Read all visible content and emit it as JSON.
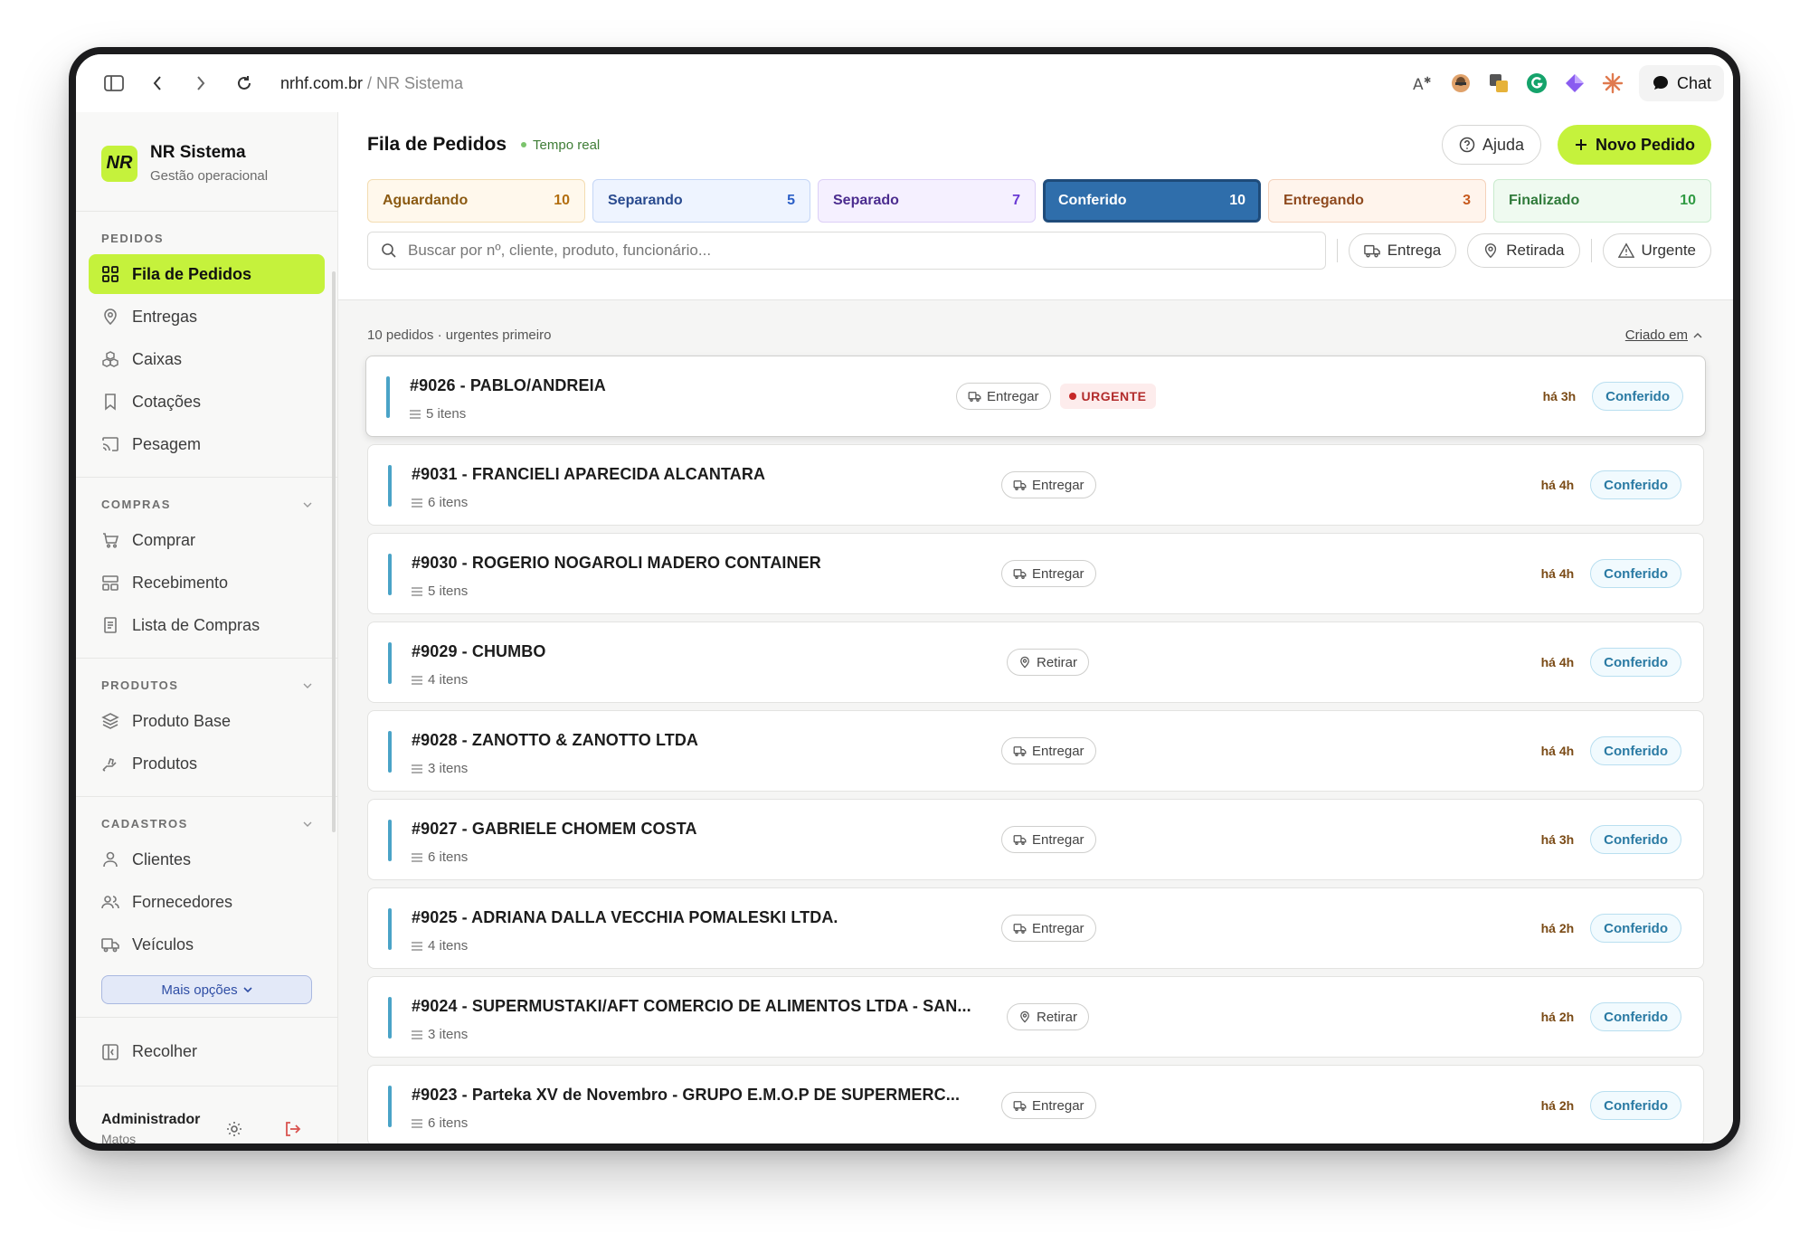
{
  "browser": {
    "domain": "nrhf.com.br",
    "path_sep": " / ",
    "page": "NR Sistema",
    "chat_label": "Chat"
  },
  "brand": {
    "logo": "NR",
    "name": "NR Sistema",
    "subtitle": "Gestão operacional"
  },
  "sidebar": {
    "sections": [
      {
        "title": "PEDIDOS",
        "items": [
          {
            "label": "Fila de Pedidos",
            "icon": "grid-icon",
            "active": true
          },
          {
            "label": "Entregas",
            "icon": "map-pin-icon"
          },
          {
            "label": "Caixas",
            "icon": "boxes-icon"
          },
          {
            "label": "Cotações",
            "icon": "bookmark-icon"
          },
          {
            "label": "Pesagem",
            "icon": "cast-icon"
          }
        ]
      },
      {
        "title": "COMPRAS",
        "items": [
          {
            "label": "Comprar",
            "icon": "cart-icon"
          },
          {
            "label": "Recebimento",
            "icon": "layout-icon"
          },
          {
            "label": "Lista de Compras",
            "icon": "list-doc-icon"
          }
        ]
      },
      {
        "title": "PRODUTOS",
        "items": [
          {
            "label": "Produto Base",
            "icon": "layers-icon"
          },
          {
            "label": "Produtos",
            "icon": "hand-icon"
          }
        ]
      },
      {
        "title": "CADASTROS",
        "items": [
          {
            "label": "Clientes",
            "icon": "user-icon"
          },
          {
            "label": "Fornecedores",
            "icon": "users-icon"
          },
          {
            "label": "Veículos",
            "icon": "truck-icon"
          }
        ]
      }
    ],
    "more_label": "Mais opções",
    "collapse_label": "Recolher",
    "user": {
      "name": "Administrador",
      "sub": "Matos"
    }
  },
  "header": {
    "title": "Fila de Pedidos",
    "live_label": "Tempo real",
    "help_label": "Ajuda",
    "new_label": "Novo Pedido"
  },
  "statuses": [
    {
      "label": "Aguardando",
      "count": "10",
      "cls": "s-aguardando"
    },
    {
      "label": "Separando",
      "count": "5",
      "cls": "s-separando"
    },
    {
      "label": "Separado",
      "count": "7",
      "cls": "s-separado"
    },
    {
      "label": "Conferido",
      "count": "10",
      "cls": "s-conferido"
    },
    {
      "label": "Entregando",
      "count": "3",
      "cls": "s-entregando"
    },
    {
      "label": "Finalizado",
      "count": "10",
      "cls": "s-finalizado"
    }
  ],
  "search": {
    "placeholder": "Buscar por nº, cliente, produto, funcionário..."
  },
  "filters": {
    "entrega": "Entrega",
    "retirada": "Retirada",
    "urgente": "Urgente"
  },
  "list": {
    "summary": "10 pedidos · urgentes primeiro",
    "sort_label": "Criado em"
  },
  "orders": [
    {
      "title": "#9026 - PABLO/ANDREIA",
      "items": "5 itens",
      "type": "Entregar",
      "urgent": "URGENTE",
      "time": "há 3h",
      "status": "Conferido"
    },
    {
      "title": "#9031 - FRANCIELI APARECIDA ALCANTARA",
      "items": "6 itens",
      "type": "Entregar",
      "time": "há 4h",
      "status": "Conferido"
    },
    {
      "title": "#9030 - ROGERIO NOGAROLI MADERO CONTAINER",
      "items": "5 itens",
      "type": "Entregar",
      "time": "há 4h",
      "status": "Conferido"
    },
    {
      "title": "#9029 - CHUMBO",
      "items": "4 itens",
      "type": "Retirar",
      "time": "há 4h",
      "status": "Conferido"
    },
    {
      "title": "#9028 - ZANOTTO & ZANOTTO LTDA",
      "items": "3 itens",
      "type": "Entregar",
      "time": "há 4h",
      "status": "Conferido"
    },
    {
      "title": "#9027 - GABRIELE CHOMEM COSTA",
      "items": "6 itens",
      "type": "Entregar",
      "time": "há 3h",
      "status": "Conferido"
    },
    {
      "title": "#9025 - ADRIANA DALLA VECCHIA POMALESKI LTDA.",
      "items": "4 itens",
      "type": "Entregar",
      "time": "há 2h",
      "status": "Conferido"
    },
    {
      "title": "#9024 - SUPERMUSTAKI/AFT COMERCIO DE ALIMENTOS LTDA - SAN...",
      "items": "3 itens",
      "type": "Retirar",
      "time": "há 2h",
      "status": "Conferido"
    },
    {
      "title": "#9023 - Parteka XV de Novembro - GRUPO E.M.O.P DE SUPERMERC...",
      "items": "6 itens",
      "type": "Entregar",
      "time": "há 2h",
      "status": "Conferido"
    }
  ]
}
